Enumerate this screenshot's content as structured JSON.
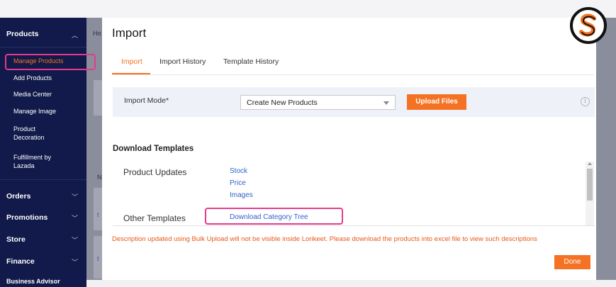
{
  "sidebar": {
    "sections": [
      {
        "label": "Products",
        "expanded": true
      },
      {
        "label": "Orders"
      },
      {
        "label": "Promotions"
      },
      {
        "label": "Store"
      },
      {
        "label": "Finance"
      },
      {
        "label": "Business Advisor"
      }
    ],
    "product_items": [
      {
        "label": "Manage Products",
        "active": true
      },
      {
        "label": "Add Products"
      },
      {
        "label": "Media Center"
      },
      {
        "label": "Manage Image"
      },
      {
        "label": "Product Decoration"
      },
      {
        "label": "Fulfillment by Lazada"
      }
    ]
  },
  "background_page": {
    "breadcrumb_fragment": "Ho",
    "fragment_n": "N",
    "fragment_t1": "t",
    "fragment_t2": "t"
  },
  "modal": {
    "title": "Import",
    "tabs": [
      {
        "label": "Import",
        "active": true
      },
      {
        "label": "Import History"
      },
      {
        "label": "Template History"
      }
    ],
    "import_mode": {
      "label": "Import Mode*",
      "selected": "Create New Products",
      "upload_label": "Upload Files",
      "info_glyph": "i"
    },
    "download_templates": {
      "title": "Download Templates",
      "product_updates_label": "Product Updates",
      "product_updates_links": [
        "Stock",
        "Price",
        "Images"
      ],
      "other_templates_label": "Other Templates",
      "other_templates_link": "Download Category Tree"
    },
    "notice": "Description updated using Bulk Upload will not be visible inside Lorikeet. Please download the products into excel file to view such descriptions",
    "done_label": "Done"
  },
  "colors": {
    "accent": "#f57224",
    "sidebar_bg": "#111a4a",
    "link": "#2f64c8",
    "highlight": "#e53a8b"
  },
  "icons": {
    "chevron": "chevron-icon",
    "info": "info-icon",
    "logo": "s-logo-icon"
  }
}
